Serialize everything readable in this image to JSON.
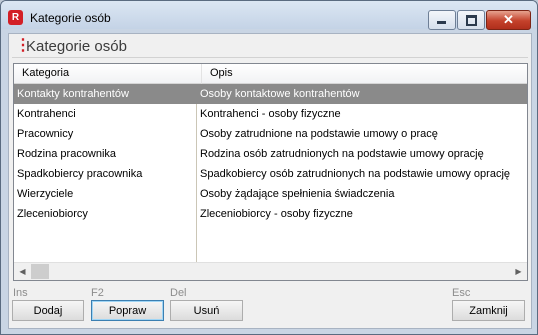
{
  "window": {
    "title": "Kategorie osób",
    "app_icon_letter": "R",
    "close_glyph": "✕"
  },
  "header": {
    "title": "Kategorie osób"
  },
  "grid": {
    "columns": [
      "Kategoria",
      "Opis"
    ],
    "rows": [
      {
        "kategoria": "Kontakty kontrahentów",
        "opis": "Osoby kontaktowe kontrahentów",
        "selected": true
      },
      {
        "kategoria": "Kontrahenci",
        "opis": "Kontrahenci - osoby fizyczne"
      },
      {
        "kategoria": "Pracownicy",
        "opis": "Osoby zatrudnione na podstawie umowy o pracę"
      },
      {
        "kategoria": "Rodzina pracownika",
        "opis": "Rodzina osób zatrudnionych na podstawie umowy oprację"
      },
      {
        "kategoria": "Spadkobiercy pracownika",
        "opis": "Spadkobiercy osób zatrudnionych na podstawie umowy oprację"
      },
      {
        "kategoria": "Wierzyciele",
        "opis": "Osoby żądające spełnienia świadczenia"
      },
      {
        "kategoria": "Zleceniobiorcy",
        "opis": "Zleceniobiorcy - osoby fizyczne"
      }
    ]
  },
  "buttons": {
    "dodaj": {
      "label": "Dodaj",
      "shortcut": "Ins"
    },
    "popraw": {
      "label": "Popraw",
      "shortcut": "F2"
    },
    "usun": {
      "label": "Usuń",
      "shortcut": "Del"
    },
    "zamknij": {
      "label": "Zamknij",
      "shortcut": "Esc"
    }
  },
  "colors": {
    "accent": "#d31f26",
    "selection": "#8a8a8a"
  }
}
